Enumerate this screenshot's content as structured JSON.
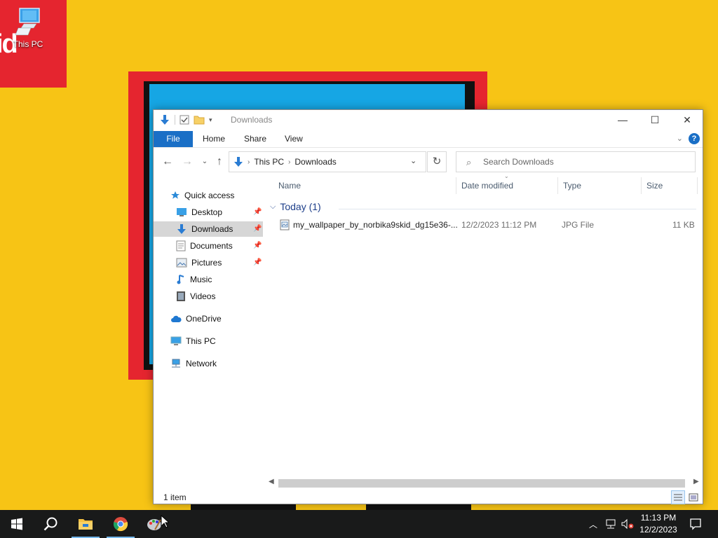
{
  "desktop": {
    "wallpaper_text": "id",
    "icons": [
      {
        "label": "This PC",
        "icon": "this-pc-icon"
      }
    ]
  },
  "window": {
    "title": "Downloads",
    "ribbon_tabs": [
      "File",
      "Home",
      "Share",
      "View"
    ],
    "address": {
      "crumbs": [
        "This PC",
        "Downloads"
      ]
    },
    "search_placeholder": "Search Downloads",
    "nav": {
      "quick_access": "Quick access",
      "items": [
        "Desktop",
        "Downloads",
        "Documents",
        "Pictures",
        "Music",
        "Videos"
      ],
      "pinned": [
        true,
        true,
        true,
        true,
        false,
        false
      ],
      "selected": "Downloads",
      "onedrive": "OneDrive",
      "this_pc": "This PC",
      "network": "Network"
    },
    "columns": [
      "Name",
      "Date modified",
      "Type",
      "Size"
    ],
    "group": "Today (1)",
    "files": [
      {
        "name": "my_wallpaper_by_norbika9skid_dg15e36-...",
        "date": "12/2/2023 11:12 PM",
        "type": "JPG File",
        "size": "11 KB",
        "icon": "image-file-icon"
      }
    ],
    "status": "1 item"
  },
  "taskbar": {
    "apps": [
      "start-icon",
      "search-icon",
      "file-explorer-icon",
      "chrome-icon",
      "paint-icon"
    ],
    "clock_time": "11:13 PM",
    "clock_date": "12/2/2023"
  },
  "colors": {
    "accent": "#1a6fc6",
    "wallpaper": "#f7c415",
    "taskbar": "#191a1a"
  }
}
